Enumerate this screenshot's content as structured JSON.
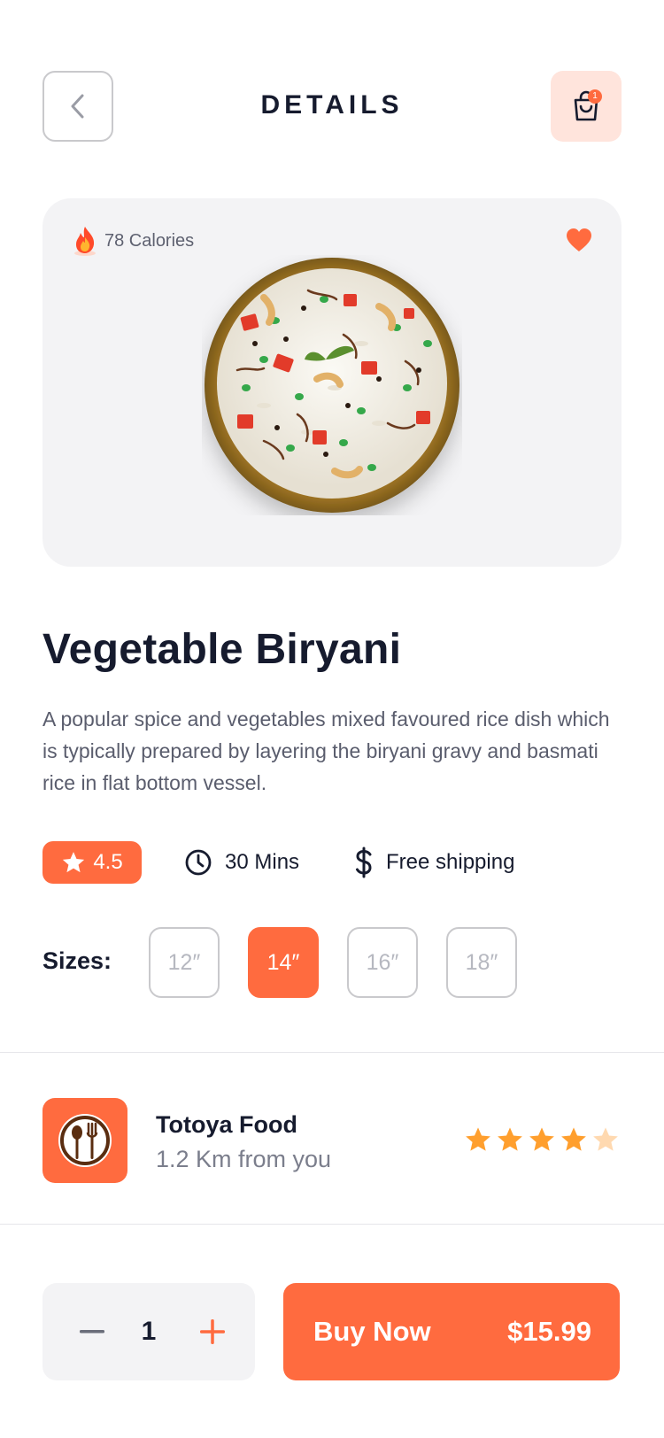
{
  "header": {
    "title": "DETAILS",
    "back_icon": "chevron-left-icon",
    "cart_icon": "shopping-bag-icon",
    "cart_badge": "1"
  },
  "hero": {
    "calories": "78 Calories",
    "calories_icon": "fire-icon",
    "favorite_icon": "heart-icon",
    "favorite_color": "#ff6b3f",
    "image": "vegetable-biryani-plate"
  },
  "dish": {
    "name": "Vegetable Biryani",
    "description": "A popular spice and vegetables mixed favoured rice dish which is typically prepared by layering the biryani gravy and basmati rice in flat bottom vessel."
  },
  "meta": {
    "rating": "4.5",
    "time": "30 Mins",
    "shipping": "Free shipping"
  },
  "sizes": {
    "label": "Sizes:",
    "options": [
      "12″",
      "14″",
      "16″",
      "18″"
    ],
    "selected": "14″"
  },
  "restaurant": {
    "name": "Totoya Food",
    "distance": "1.2 Km from you",
    "rating_stars": 4.5,
    "logo_icon": "spoon-fork-icon"
  },
  "order": {
    "quantity": "1",
    "buy_label": "Buy Now",
    "price": "$15.99"
  },
  "colors": {
    "accent": "#ff6b3f",
    "accent_light": "#ffe4dc",
    "card_bg": "#f3f3f5",
    "text_dark": "#161b2e",
    "star": "#ff9f2e"
  }
}
